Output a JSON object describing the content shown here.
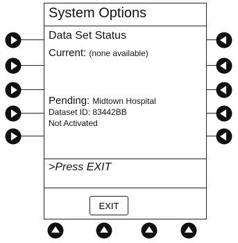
{
  "screen": {
    "title": "System Options",
    "section_title": "Data Set Status",
    "current_label": "Current:",
    "current_value": "(none available)",
    "pending_label": "Pending:",
    "pending_value": "Midtown Hospital",
    "dataset_id": "Dataset ID: 83442BB",
    "activation_status": "Not Activated",
    "prompt": ">Press EXIT",
    "exit_label": "EXIT"
  },
  "softkeys": {
    "left": [
      "left-softkey-1",
      "left-softkey-2",
      "left-softkey-3",
      "left-softkey-4",
      "left-softkey-5"
    ],
    "right": [
      "right-softkey-1",
      "right-softkey-2",
      "right-softkey-3",
      "right-softkey-4",
      "right-softkey-5"
    ],
    "bottom": [
      "bottom-softkey-1",
      "bottom-softkey-2",
      "bottom-softkey-3",
      "bottom-softkey-4"
    ],
    "icon_left": "arrow-right-icon",
    "icon_right": "arrow-left-icon",
    "icon_bottom": "arrow-up-icon",
    "button_color": "#111111"
  }
}
